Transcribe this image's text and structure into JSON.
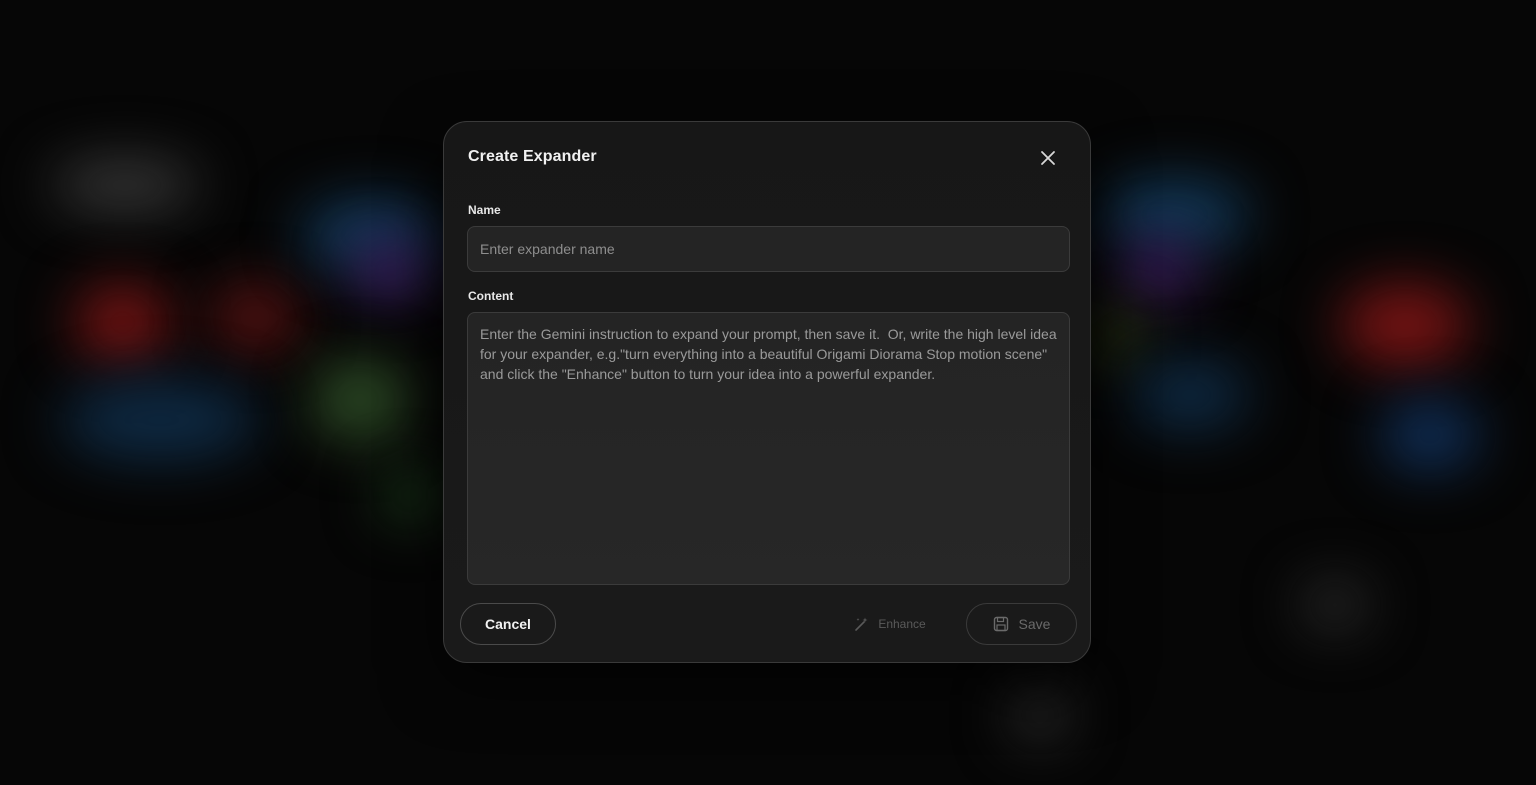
{
  "dialog": {
    "title": "Create Expander",
    "close_icon": "close-icon"
  },
  "name_field": {
    "label": "Name",
    "value": "",
    "placeholder": "Enter expander name"
  },
  "content_field": {
    "label": "Content",
    "value": "",
    "placeholder": "Enter the Gemini instruction to expand your prompt, then save it.  Or, write the high level idea for your expander, e.g.\"turn everything into a beautiful Origami Diorama Stop motion scene\" and click the \"Enhance\" button to turn your idea into a powerful expander."
  },
  "footer": {
    "cancel_label": "Cancel",
    "enhance_label": "Enhance",
    "enhance_icon": "magic-wand-icon",
    "save_label": "Save",
    "save_icon": "save-icon"
  },
  "colors": {
    "dialog_bg": "#171717",
    "border": "#3a3a3a",
    "text_primary": "#f1f1f1",
    "text_disabled": "#5a5a5a"
  }
}
